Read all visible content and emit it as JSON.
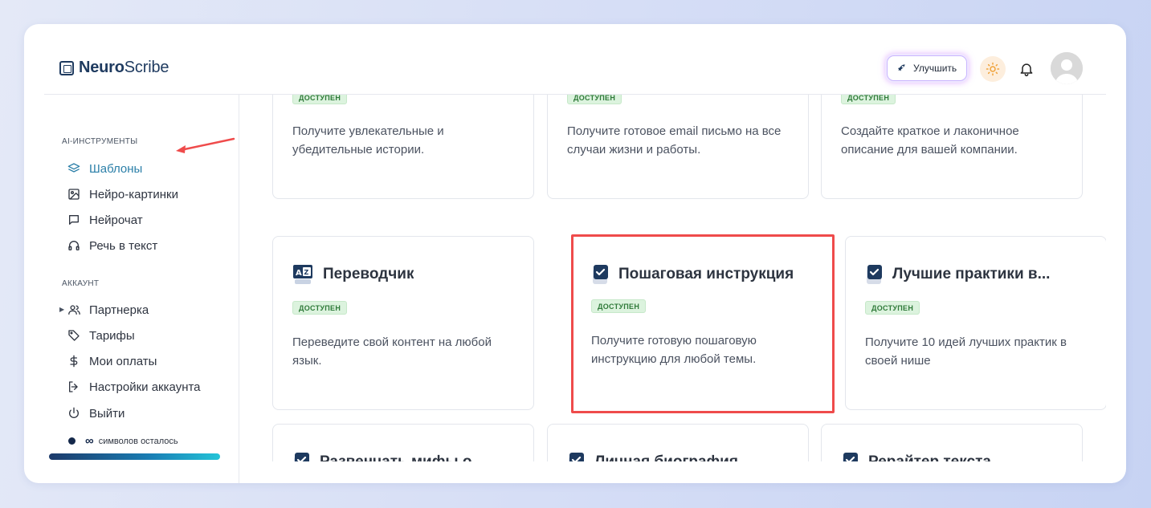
{
  "app": {
    "logo_bold": "Neuro",
    "logo_rest": "Scribe"
  },
  "header": {
    "upgrade_label": "Улучшить"
  },
  "sidebar": {
    "section_tools": "AI-ИНСТРУМЕНТЫ",
    "tools": [
      {
        "label": "Шаблоны",
        "icon": "layers-icon",
        "active": true
      },
      {
        "label": "Нейро-картинки",
        "icon": "image-icon"
      },
      {
        "label": "Нейрочат",
        "icon": "chat-icon"
      },
      {
        "label": "Речь в текст",
        "icon": "headphones-icon"
      }
    ],
    "section_account": "АККАУНТ",
    "account": [
      {
        "label": "Партнерка",
        "icon": "users-icon"
      },
      {
        "label": "Тарифы",
        "icon": "tag-icon"
      },
      {
        "label": "Мои оплаты",
        "icon": "dollar-icon"
      },
      {
        "label": "Настройки аккаунта",
        "icon": "logout-box-icon"
      },
      {
        "label": "Выйти",
        "icon": "power-icon"
      }
    ],
    "credits_symbol": "∞",
    "credits_text": "символов осталось",
    "credits_fill_fraction": 1.0
  },
  "cards": [
    {
      "title": "",
      "badge": "ДОСТУПЕН",
      "desc": "Получите увлекательные и убедительные истории."
    },
    {
      "title": "",
      "badge": "ДОСТУПЕН",
      "desc": "Получите готовое email письмо на все случаи жизни и работы."
    },
    {
      "title": "",
      "badge": "ДОСТУПЕН",
      "desc": "Создайте краткое и лаконичное описание для вашей компании."
    },
    {
      "title": "Переводчик",
      "badge": "ДОСТУПЕН",
      "desc": "Переведите свой контент на любой язык.",
      "icon": "translate-icon"
    },
    {
      "title": "Пошаговая инструкция",
      "badge": "ДОСТУПЕН",
      "desc": "Получите готовую пошаговую инструкцию для любой темы.",
      "icon": "checkbox-icon",
      "highlighted": true
    },
    {
      "title": "Лучшие практики в...",
      "badge": "ДОСТУПЕН",
      "desc": "Получите 10 идей лучших практик в своей нише",
      "icon": "checkbox-icon"
    },
    {
      "title": "Развенчать мифы о...",
      "badge": "",
      "desc": "",
      "icon": "checkbox-icon"
    },
    {
      "title": "Личная биография",
      "badge": "",
      "desc": "",
      "icon": "checkbox-icon"
    },
    {
      "title": "Рерайтер текста",
      "badge": "",
      "desc": "",
      "icon": "checkbox-icon"
    }
  ],
  "colors": {
    "accent": "#2b7fa8",
    "highlight": "#ef4b4b",
    "badge_bg": "#dcf3de",
    "badge_text": "#2f7a39",
    "navy": "#1e3a5f"
  }
}
